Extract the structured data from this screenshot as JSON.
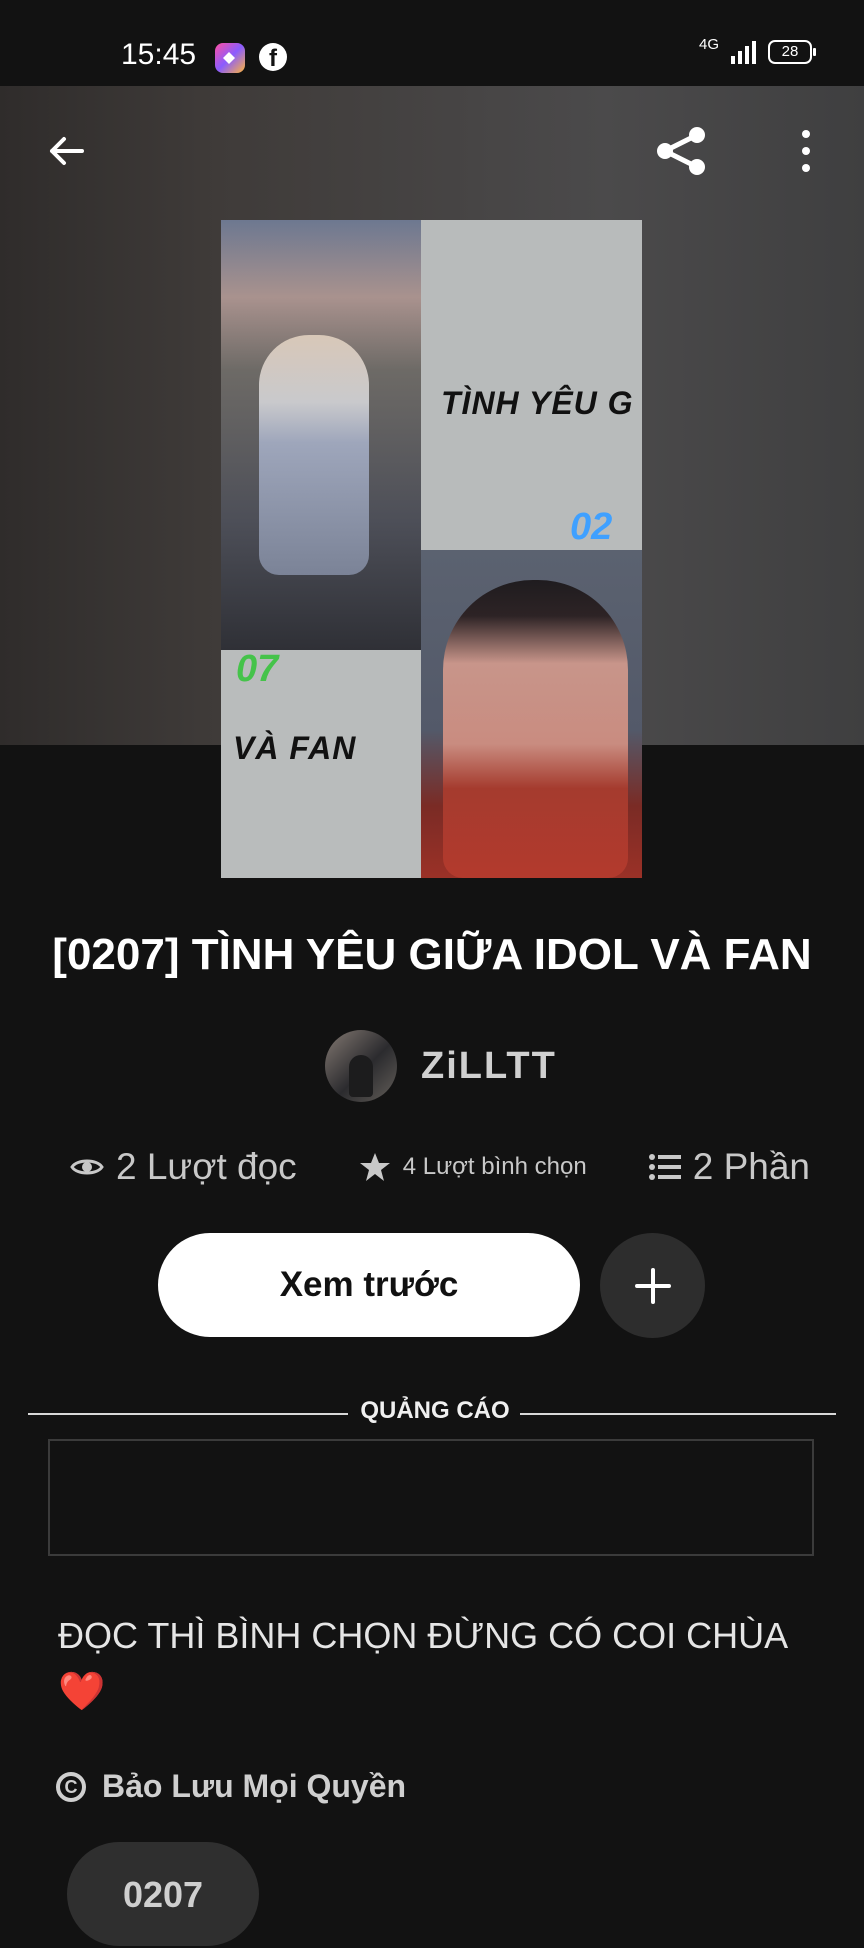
{
  "status_bar": {
    "time": "15:45",
    "network": "4G",
    "battery": "28"
  },
  "navigation": {
    "back_icon": "arrow-left-icon",
    "share_icon": "share-icon",
    "more_icon": "more-vertical-icon"
  },
  "cover": {
    "text_top": "TÌNH YÊU G",
    "number_top": "02",
    "number_bottom": "07",
    "text_bottom": "VÀ FAN"
  },
  "book": {
    "title": "[0207] TÌNH YÊU GIỮA IDOL VÀ FAN",
    "author": "ZiLLTT",
    "stats": [
      {
        "icon": "eye-icon",
        "label": "2 Lượt đọc"
      },
      {
        "icon": "star-icon",
        "label": "4 Lượt bình chọn"
      },
      {
        "icon": "list-icon",
        "label": "2 Phần"
      }
    ],
    "actions": {
      "preview": "Xem trước",
      "add_icon": "plus-icon"
    },
    "ad_label": "QUẢNG CÁO",
    "description": "ĐỌC THÌ BÌNH CHỌN ĐỪNG CÓ COI CHÙA",
    "description_emoji": "❤️",
    "copyright": "Bảo Lưu Mọi Quyền",
    "tag": "0207"
  },
  "colors": {
    "background": "#121212",
    "primary_button": "#ffffff",
    "secondary_button": "#2d2d2d"
  }
}
